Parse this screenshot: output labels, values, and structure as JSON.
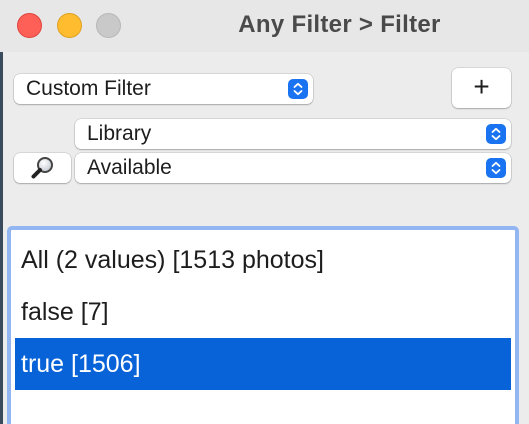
{
  "window": {
    "title": "Any Filter > Filter"
  },
  "filter_popup": {
    "value": "Custom Filter"
  },
  "add_button": {
    "label": "+"
  },
  "scope_popup": {
    "value": "Library"
  },
  "field_popup": {
    "value": "Available"
  },
  "values_list": {
    "items": [
      {
        "label": "All (2 values) [1513 photos]",
        "selected": false
      },
      {
        "label": "false [7]",
        "selected": false
      },
      {
        "label": "true [1506]",
        "selected": true
      }
    ]
  },
  "colors": {
    "selection": "#0863d9",
    "focus_ring": "#92b6f2",
    "stepper": "#1a73f0",
    "close": "#fe5f57",
    "minimize": "#febc2e",
    "zoom_disabled": "#c9c9c9"
  },
  "icons": {
    "search": "magnifier-icon",
    "stepper": "chevron-up-down-icon"
  }
}
